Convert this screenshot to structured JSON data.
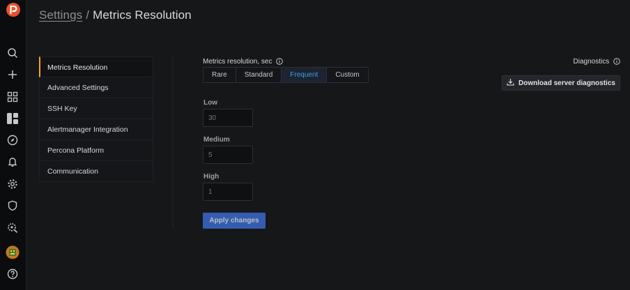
{
  "header": {
    "breadcrumb": "Settings",
    "separator": "/",
    "title": "Metrics Resolution"
  },
  "nav_rail": {
    "items": [
      "search-icon",
      "plus-icon",
      "apps-icon",
      "dashboards-icon",
      "compass-icon",
      "bell-icon",
      "gear-icon",
      "shield-icon",
      "search-plus-icon",
      "avatar",
      "help-icon"
    ]
  },
  "menu": {
    "items": [
      {
        "label": "Metrics Resolution",
        "active": true
      },
      {
        "label": "Advanced Settings",
        "active": false
      },
      {
        "label": "SSH Key",
        "active": false
      },
      {
        "label": "Alertmanager Integration",
        "active": false
      },
      {
        "label": "Percona Platform",
        "active": false
      },
      {
        "label": "Communication",
        "active": false
      }
    ]
  },
  "resolution": {
    "label": "Metrics resolution, sec",
    "options": [
      "Rare",
      "Standard",
      "Frequent",
      "Custom"
    ],
    "selected": "Frequent",
    "fields": {
      "low_label": "Low",
      "low_value": "30",
      "medium_label": "Medium",
      "medium_value": "5",
      "high_label": "High",
      "high_value": "1"
    },
    "apply_label": "Apply changes"
  },
  "diagnostics": {
    "label": "Diagnostics",
    "button_label": "Download server diagnostics"
  },
  "colors": {
    "accent": "#f5a524",
    "primary": "#3d71d9",
    "selected_text": "#33a2e5",
    "logo": "#e8512e"
  }
}
